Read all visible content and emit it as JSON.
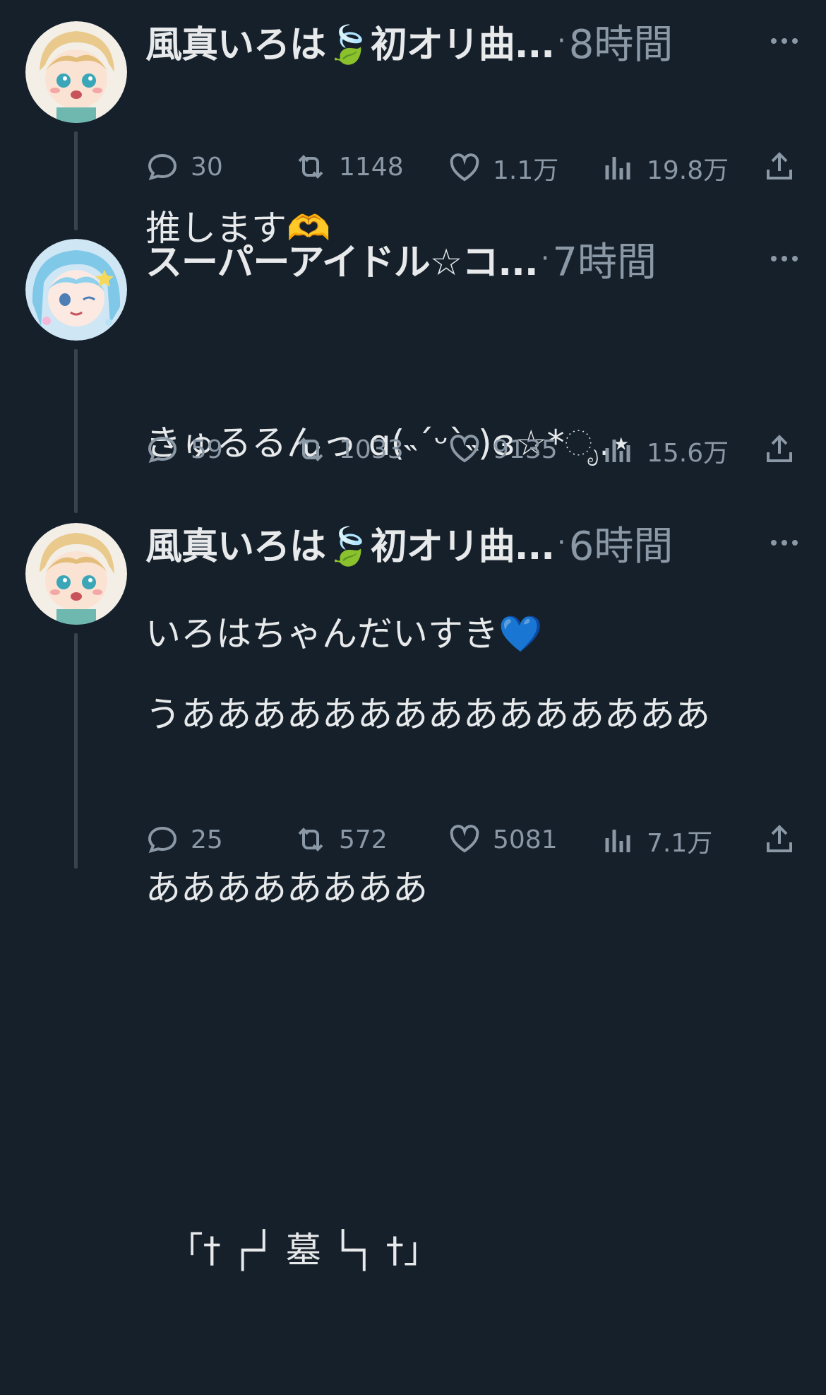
{
  "colors": {
    "background": "#15202b",
    "text": "#e7e9ea",
    "muted": "#8b98a5",
    "line": "#38444d",
    "heart_emoji": "#2f6fe0"
  },
  "tweets": [
    {
      "name": "風真いろは🍃初オリ曲...",
      "time": "8時間",
      "text_lines": [
        "推します🫶"
      ],
      "replies": "30",
      "retweets": "1148",
      "likes": "1.1万",
      "views": "19.8万",
      "avatar": "iroha-avatar"
    },
    {
      "name": "スーパーアイドル☆コ...",
      "time": "7時間",
      "text_lines": [
        "きゅるるんっ ɑ(˵ˊᵕˋ˵)ɞ☆*ೃ.⋆",
        "いろはちゃんだいすき💙"
      ],
      "replies": "59",
      "retweets": "1033",
      "likes": "9135",
      "views": "15.6万",
      "avatar": "idol-avatar"
    },
    {
      "name": "風真いろは🍃初オリ曲...",
      "time": "6時間",
      "text_lines": [
        "うあああああああああああああああ",
        "ああああああああ",
        "",
        "  「† ┌┘ 墓 └┐ †」"
      ],
      "replies": "25",
      "retweets": "572",
      "likes": "5081",
      "views": "7.1万",
      "avatar": "iroha-avatar"
    }
  ]
}
